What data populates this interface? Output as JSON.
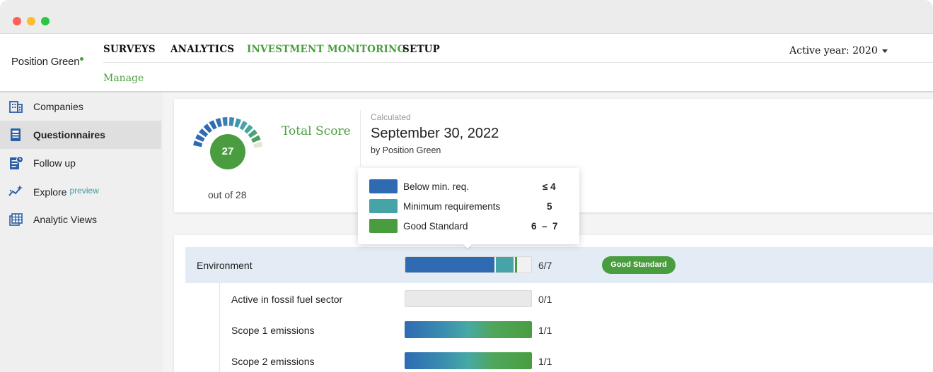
{
  "window": {
    "controls": [
      "close",
      "minimize",
      "maximize"
    ]
  },
  "brand": {
    "name": "Position Green",
    "accent": "#4a9d3f"
  },
  "nav": {
    "items": [
      {
        "label": "SURVEYS"
      },
      {
        "label": "ANALYTICS"
      },
      {
        "label": "INVESTMENT MONITORING",
        "active": true
      },
      {
        "label": "SETUP"
      }
    ],
    "sub_item": "Manage",
    "active_year": "Active year: 2020"
  },
  "sidebar": {
    "items": [
      {
        "label": "Companies",
        "icon": "building-icon"
      },
      {
        "label": "Questionnaires",
        "icon": "questionnaire-icon",
        "active": true
      },
      {
        "label": "Follow up",
        "icon": "follow-up-icon"
      },
      {
        "label": "Explore",
        "icon": "explore-icon",
        "badge": "preview"
      },
      {
        "label": "Analytic Views",
        "icon": "analytic-views-icon"
      }
    ]
  },
  "score": {
    "value": "27",
    "out_of": "out of 28",
    "title": "Total Score",
    "calculated_label": "Calculated",
    "calculated_date": "September 30, 2022",
    "calculated_by": "by Position Green"
  },
  "legend": [
    {
      "label": "Below min. req.",
      "range": "≤ 4",
      "color": "#2f6bb3"
    },
    {
      "label": "Minimum requirements",
      "range": "5",
      "color": "#46a3a8"
    },
    {
      "label": "Good Standard",
      "range": "6  –  7",
      "color": "#4a9d3f"
    }
  ],
  "rows": [
    {
      "label": "Environment",
      "score": "6/7",
      "badge": "Good Standard",
      "category": true,
      "fill": 0.857
    },
    {
      "label": "Active in fossil fuel sector",
      "score": "0/1",
      "fill": 0
    },
    {
      "label": "Scope 1 emissions",
      "score": "1/1",
      "fill": 1
    },
    {
      "label": "Scope 2 emissions",
      "score": "1/1",
      "fill": 1
    }
  ]
}
